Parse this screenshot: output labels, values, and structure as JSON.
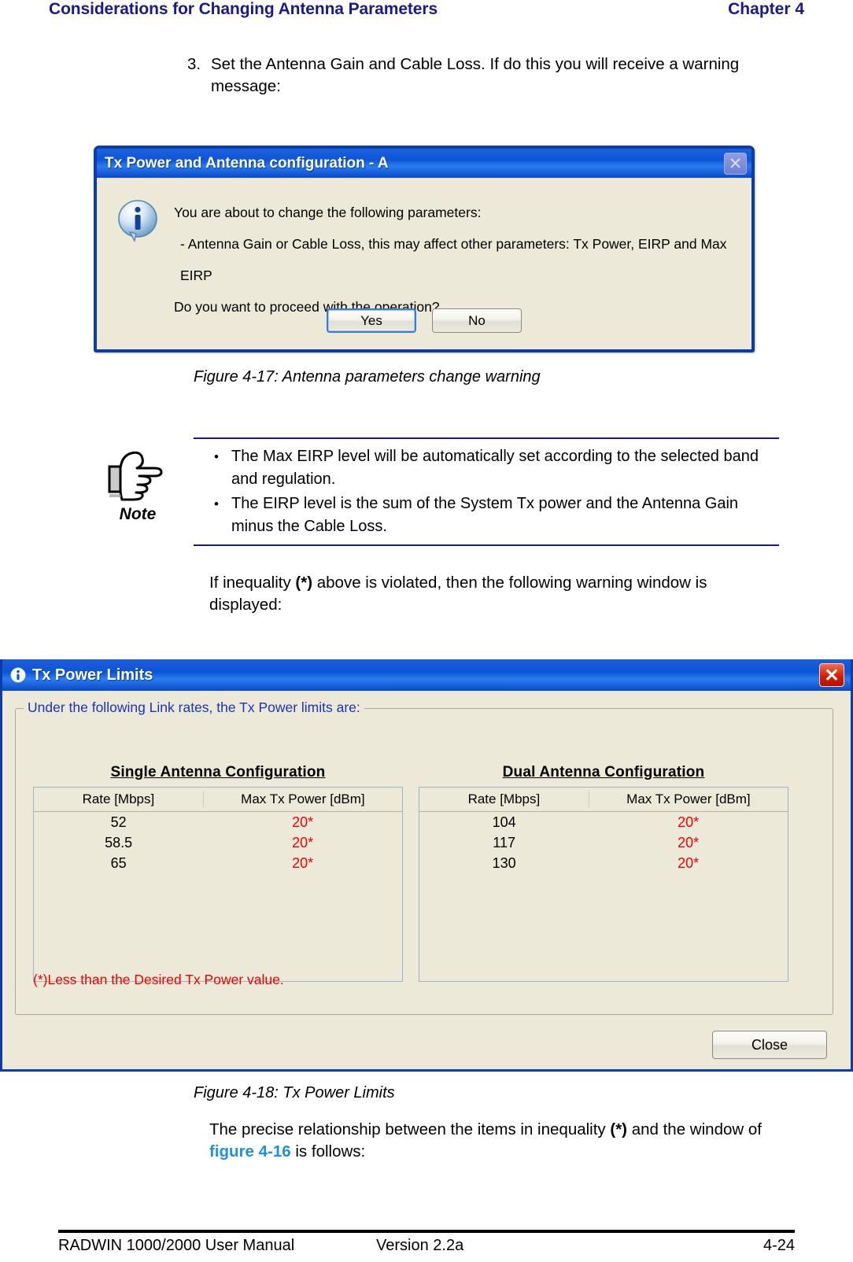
{
  "running_head": {
    "left": "Considerations for Changing Antenna Parameters",
    "right": "Chapter 4",
    "color": "#1a1a8c"
  },
  "step": {
    "number": "3.",
    "text": "Set the Antenna Gain and Cable Loss. If do this you will receive a warning message:"
  },
  "dialog_warning": {
    "title": "Tx Power and Antenna configuration - A",
    "close_icon": "close-x-icon",
    "info_icon": "info-icon",
    "message_line1": "You are about to change the following parameters:",
    "message_line2": "- Antenna Gain or Cable Loss, this may affect other parameters: Tx Power, EIRP and Max EIRP",
    "message_line3": "Do you want to proceed with the operation?",
    "yes_label": "Yes",
    "no_label": "No"
  },
  "figure_17_caption": "Figure 4-17: Antenna parameters change warning",
  "note": {
    "label": "Note",
    "icon": "pointing-hand-icon",
    "bullets": [
      "The Max EIRP level will be automatically set according to the selected band and regulation.",
      "The EIRP level is the sum of the System Tx power and the Antenna Gain minus the Cable Loss."
    ]
  },
  "paragraph_inequality": {
    "part1": "If inequality ",
    "bold1": "(*)",
    "part2": " above is violated, then the following warning window is displayed:"
  },
  "dialog_limits": {
    "title": "Tx Power Limits",
    "title_icon": "info-icon",
    "close_icon": "close-x-icon",
    "group_title": "Under the following Link rates, the Tx Power limits are:",
    "tables": [
      {
        "heading": "Single Antenna Configuration",
        "columns": [
          "Rate [Mbps]",
          "Max Tx Power [dBm]"
        ],
        "rows": [
          [
            "52",
            "20*"
          ],
          [
            "58.5",
            "20*"
          ],
          [
            "65",
            "20*"
          ]
        ]
      },
      {
        "heading": "Dual Antenna Configuration",
        "columns": [
          "Rate [Mbps]",
          "Max Tx Power [dBm]"
        ],
        "rows": [
          [
            "104",
            "20*"
          ],
          [
            "117",
            "20*"
          ],
          [
            "130",
            "20*"
          ]
        ]
      }
    ],
    "footnote": "(*)Less than the Desired Tx Power value.",
    "footnote_color": "#ee0000",
    "close_label": "Close"
  },
  "figure_18_caption": "Figure 4-18: Tx Power Limits",
  "paragraph_relationship": {
    "part1": "The precise relationship between the items in inequality ",
    "bold1": "(*)",
    "part2": " and the window of ",
    "xref": "figure 4-16",
    "part3": " is follows:"
  },
  "footer": {
    "manual": "RADWIN 1000/2000 User Manual",
    "version": "Version  2.2a",
    "page": "4-24"
  }
}
